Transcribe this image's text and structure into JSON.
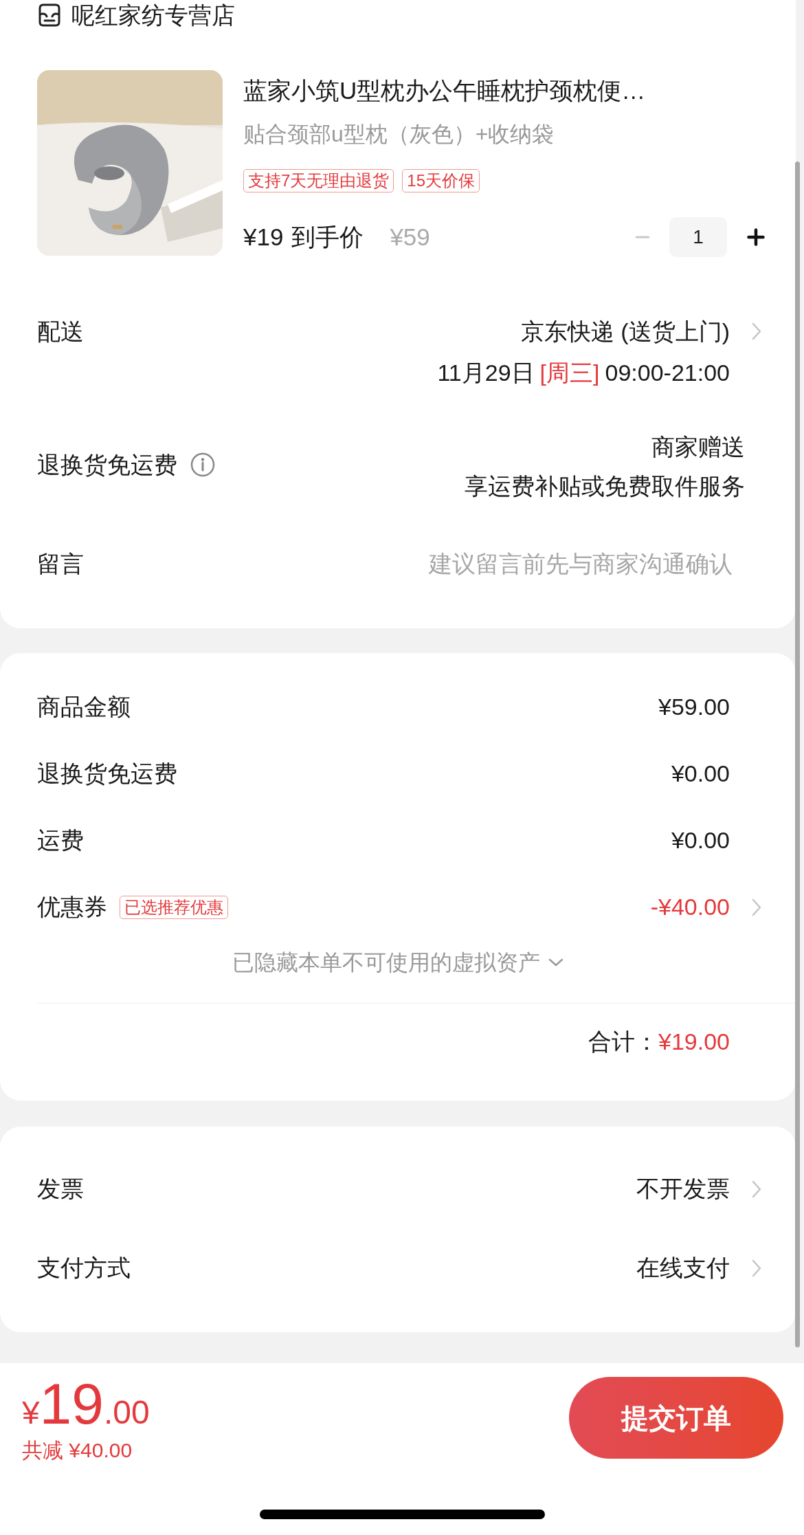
{
  "store": {
    "name": "呢红家纺专营店"
  },
  "product": {
    "title": "蓝家小筑U型枕办公午睡枕护颈枕便…",
    "variant": "贴合颈部u型枕（灰色）+收纳袋",
    "tags": [
      "支持7天无理由退货",
      "15天价保"
    ],
    "price": "¥19",
    "price_label": "到手价",
    "original_price": "¥59",
    "quantity": "1"
  },
  "delivery": {
    "label": "配送",
    "carrier": "京东快递 (送货上门)",
    "date": "11月29日",
    "weekday": "[周三]",
    "time": "09:00-21:00"
  },
  "return_shipping": {
    "label": "退换货免运费",
    "value": "商家赠送",
    "note": "享运费补贴或免费取件服务"
  },
  "message": {
    "label": "留言",
    "placeholder": "建议留言前先与商家沟通确认"
  },
  "summary": {
    "rows": [
      {
        "kind": "plain",
        "label": "商品金额",
        "value": "¥59.00"
      },
      {
        "kind": "plain",
        "label": "退换货免运费",
        "value": "¥0.00"
      },
      {
        "kind": "plain",
        "label": "运费",
        "value": "¥0.00"
      },
      {
        "kind": "coupon",
        "label": "优惠券",
        "badge": "已选推荐优惠",
        "value": "-¥40.00"
      }
    ],
    "hidden_assets": "已隐藏本单不可使用的虚拟资产",
    "total_label": "合计：",
    "total": "¥19.00"
  },
  "options": [
    {
      "label": "发票",
      "value": "不开发票"
    },
    {
      "label": "支付方式",
      "value": "在线支付"
    }
  ],
  "footer": {
    "currency": "¥",
    "price_int": "19",
    "price_dec": ".00",
    "discount": "共减 ¥40.00",
    "submit": "提交订单"
  }
}
